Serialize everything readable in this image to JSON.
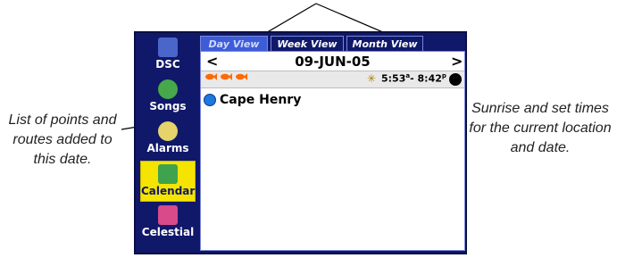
{
  "captions": {
    "left": "List of points and routes added to this date.",
    "right": "Sunrise and set times for the current location and date."
  },
  "sidebar": {
    "items": [
      {
        "label": "DSC",
        "icon": "dsc-icon",
        "active": false
      },
      {
        "label": "Songs",
        "icon": "songs-icon",
        "active": false
      },
      {
        "label": "Alarms",
        "icon": "alarm-clock-icon",
        "active": false
      },
      {
        "label": "Calendar",
        "icon": "calendar-icon",
        "active": true
      },
      {
        "label": "Celestial",
        "icon": "celestial-icon",
        "active": false
      }
    ]
  },
  "tabs": [
    {
      "label": "Day View",
      "active": true
    },
    {
      "label": "Week View",
      "active": false
    },
    {
      "label": "Month View",
      "active": false
    }
  ],
  "date_bar": {
    "prev_arrow": "<",
    "next_arrow": ">",
    "date": "09-JUN-05"
  },
  "info_bar": {
    "fish_icons": 3,
    "sunrise": "5:53",
    "sunrise_suffix": "a",
    "sunset": "8:42",
    "sunset_suffix": "p",
    "separator": "-"
  },
  "entries": [
    {
      "name": "Cape Henry",
      "icon": "waypoint-icon"
    }
  ],
  "colors": {
    "screen_bg": "#10186a",
    "active_tab": "#3d5cd8",
    "active_sidebar": "#f4e400",
    "fish": "#ff6a00"
  }
}
